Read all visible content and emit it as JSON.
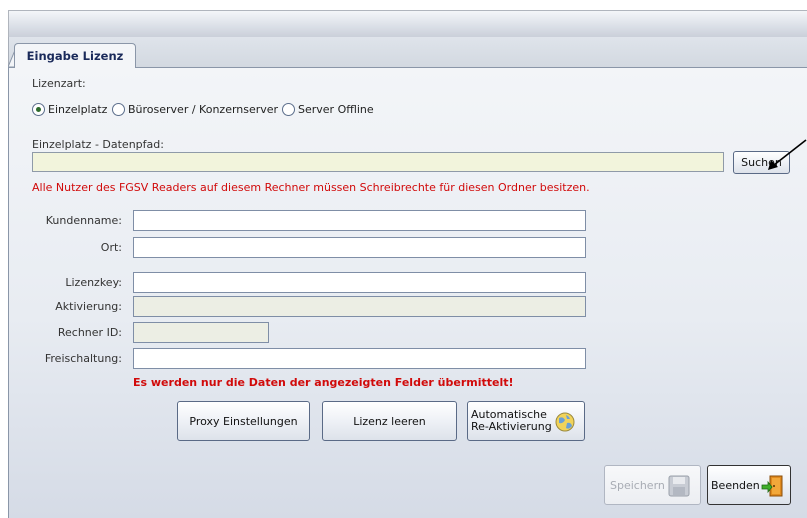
{
  "tab": {
    "label": "Eingabe Lizenz"
  },
  "lizenzart": {
    "label": "Lizenzart:",
    "options": [
      {
        "label": "Einzelplatz",
        "checked": true
      },
      {
        "label": "Büroserver / Konzernserver",
        "checked": false
      },
      {
        "label": "Server Offline",
        "checked": false
      }
    ]
  },
  "datenpfad": {
    "label": "Einzelplatz - Datenpfad:",
    "value": "",
    "search_label": "Suchen",
    "hint": "Alle Nutzer des FGSV Readers auf diesem Rechner müssen Schreibrechte für diesen Ordner besitzen."
  },
  "form": {
    "kundenname": {
      "label": "Kundenname:",
      "value": ""
    },
    "ort": {
      "label": "Ort:",
      "value": ""
    },
    "lizenzkey": {
      "label": "Lizenzkey:",
      "value": ""
    },
    "aktivierung": {
      "label": "Aktivierung:",
      "value": ""
    },
    "rechner_id": {
      "label": "Rechner ID:",
      "value": ""
    },
    "freischaltung": {
      "label": "Freischaltung:",
      "value": ""
    }
  },
  "notice": "Es werden nur die Daten der angezeigten Felder übermittelt!",
  "buttons": {
    "proxy": "Proxy Einstellungen",
    "clear": "Lizenz leeren",
    "reactivate_line1": "Automatische",
    "reactivate_line2": "Re-Aktivierung",
    "save": "Speichern",
    "exit": "Beenden"
  },
  "icons": {
    "globe": "globe-refresh-icon",
    "save": "floppy-disk-icon",
    "exit": "door-exit-icon",
    "pointer": "arrow-pointer-icon"
  },
  "colors": {
    "warning": "#d10a0a",
    "field_readonly": "#eceee4",
    "path_field": "#f2f4dc"
  }
}
